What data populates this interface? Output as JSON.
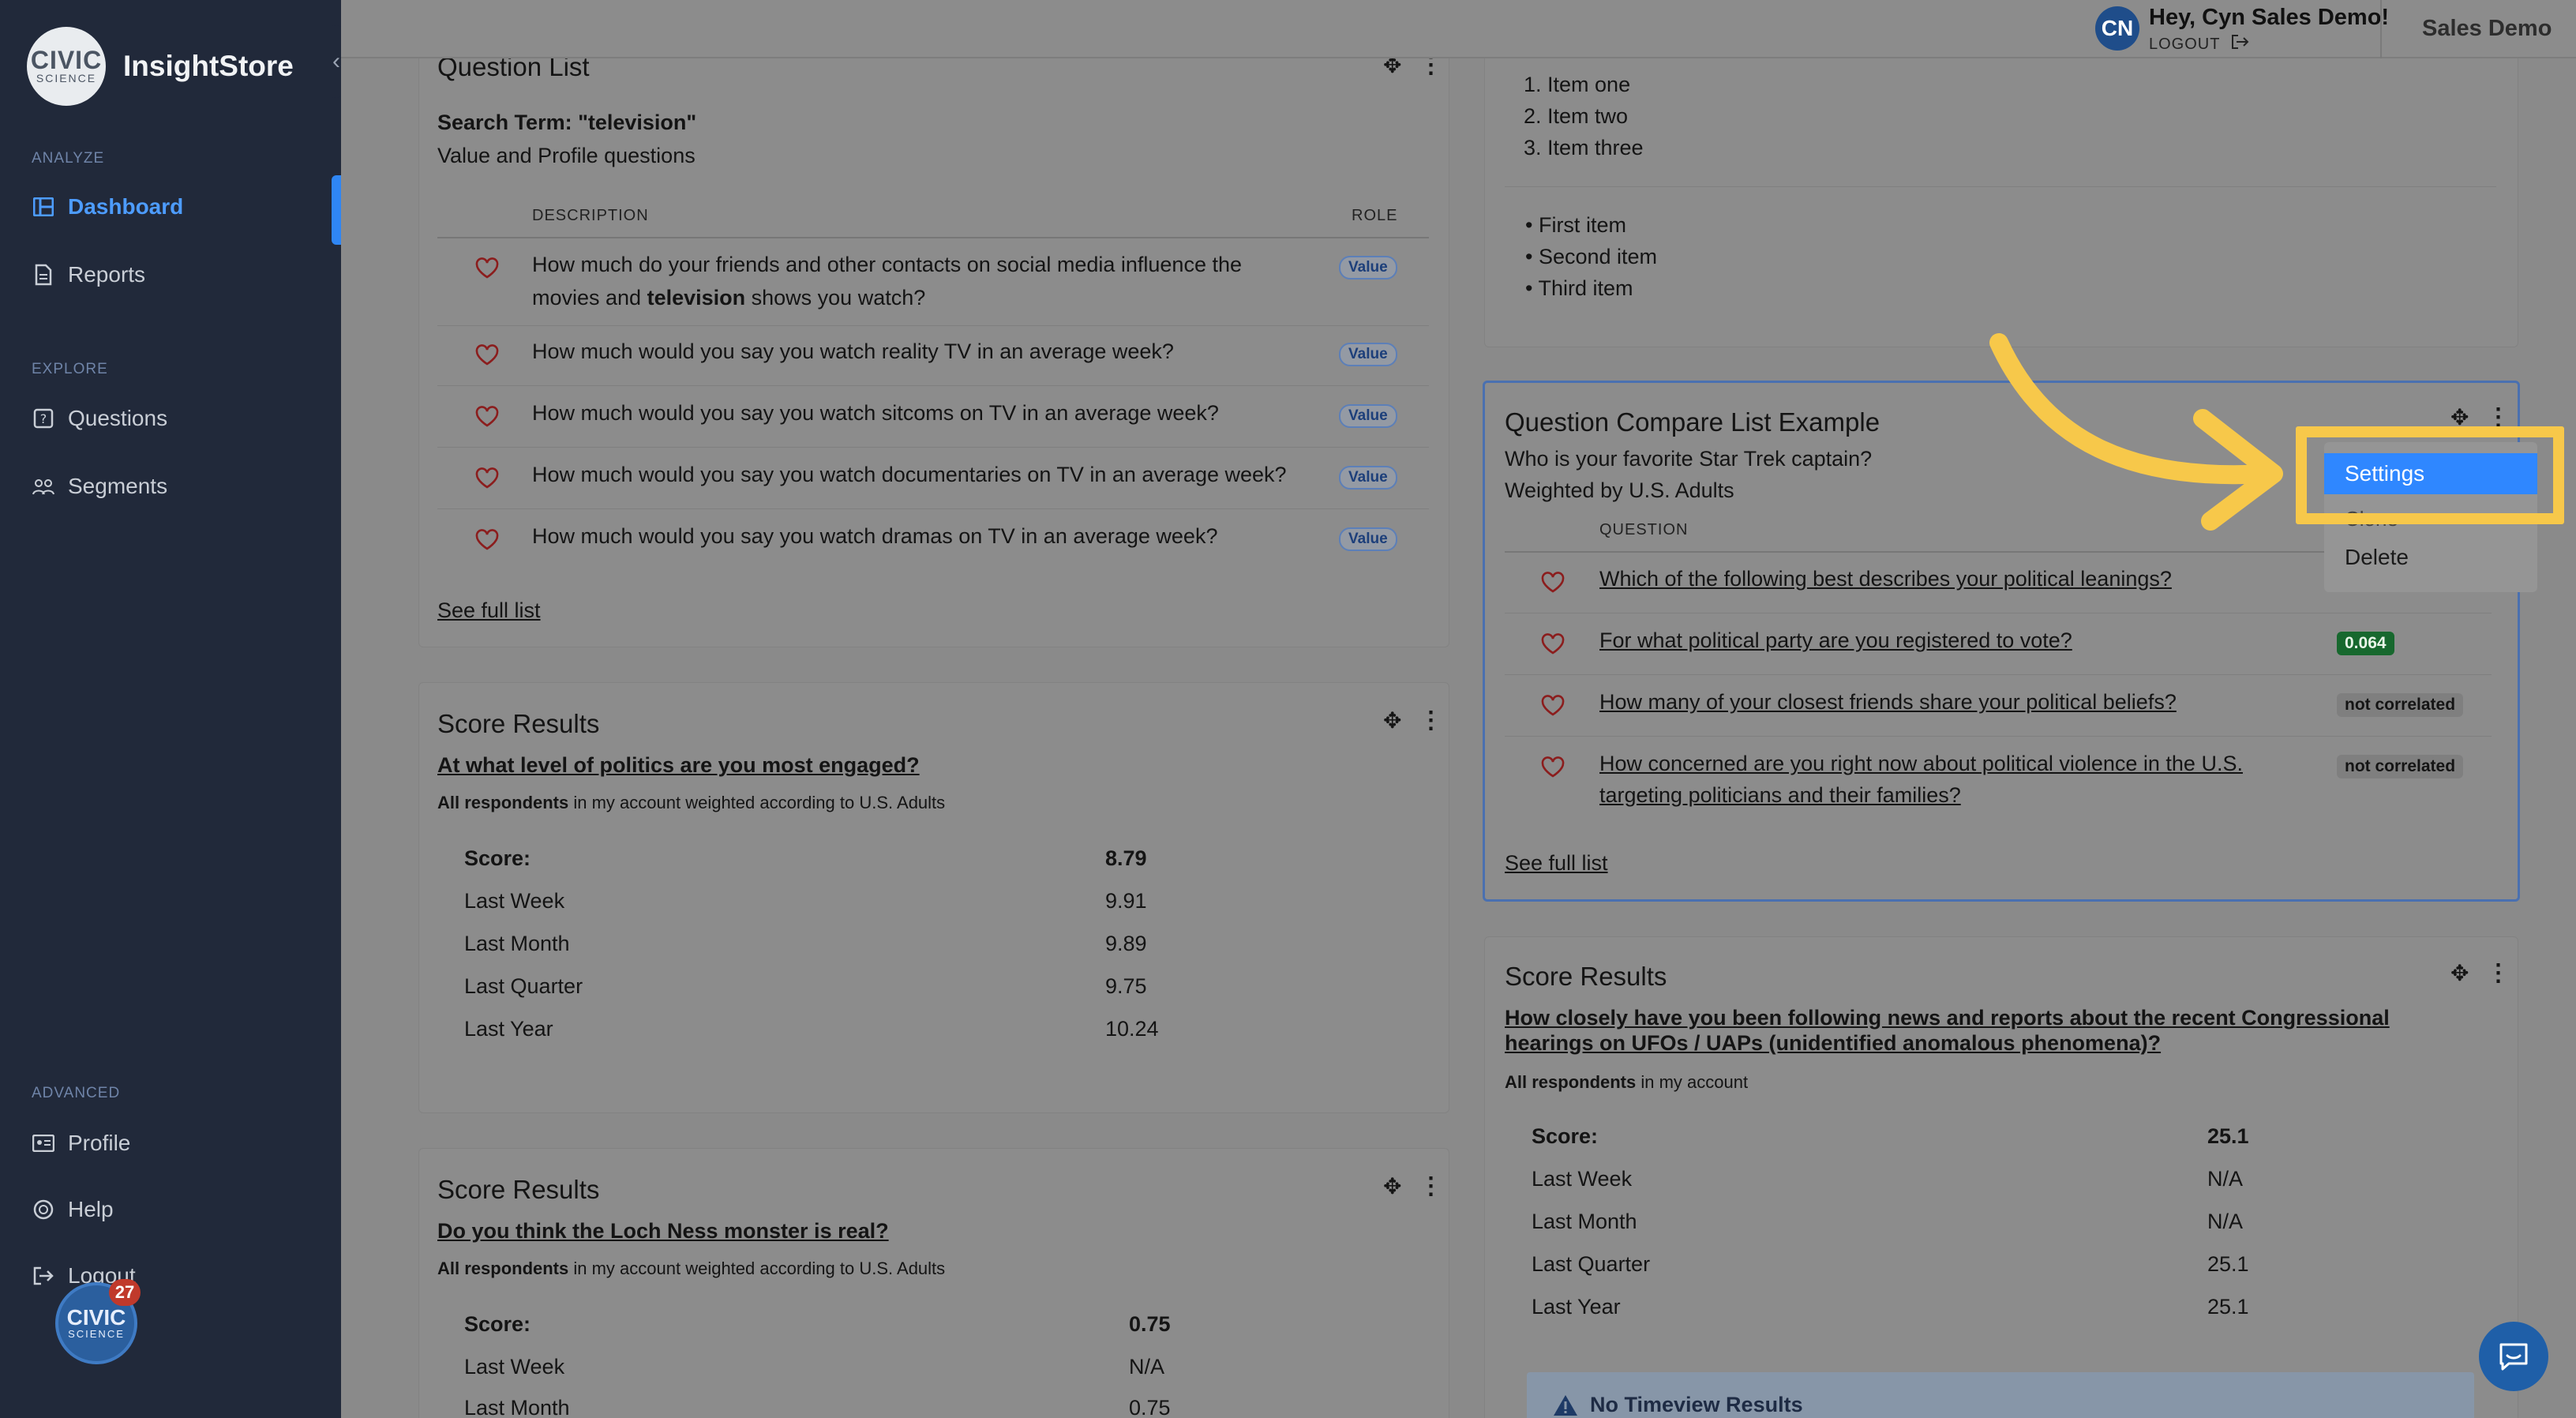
{
  "sidebar": {
    "logo_line1": "CIVIC",
    "logo_line2": "SCIENCE",
    "app_name": "InsightStore",
    "collapse_glyph": "‹",
    "sections": {
      "analyze": "ANALYZE",
      "explore": "EXPLORE",
      "advanced": "ADVANCED"
    },
    "items": {
      "dashboard": "Dashboard",
      "reports": "Reports",
      "questions": "Questions",
      "segments": "Segments",
      "profile": "Profile",
      "help": "Help",
      "logout": "Logout"
    },
    "badge": {
      "line1": "CIVIC",
      "line2": "SCIENCE",
      "count": "27"
    }
  },
  "topbar": {
    "avatar_initials": "CN",
    "greeting": "Hey, Cyn Sales Demo!",
    "logout": "LOGOUT",
    "account": "Sales Demo"
  },
  "question_list": {
    "title": "Question List",
    "search_term": "Search Term: \"television\"",
    "subtitle": "Value and Profile questions",
    "col_description": "DESCRIPTION",
    "col_role": "ROLE",
    "row0_pre": "How much do your friends and other contacts on social media influence the",
    "row0_mid": "movies and ",
    "row0_bold": "television",
    "row0_post": " shows you watch?",
    "rows": [
      {
        "text": "How much would you say you watch reality TV in an average week?",
        "role": "Value"
      },
      {
        "text": "How much would you say you watch sitcoms on TV in an average week?",
        "role": "Value"
      },
      {
        "text": "How much would you say you watch documentaries on TV in an average week?",
        "role": "Value"
      },
      {
        "text": "How much would you say you watch dramas on TV in an average week?",
        "role": "Value"
      }
    ],
    "row0_role": "Value",
    "see_full": "See full list"
  },
  "lists_card": {
    "ordered": [
      "1. Item one",
      "2. Item two",
      "3. Item three"
    ],
    "unordered": [
      "• First item",
      "• Second item",
      "• Third item"
    ]
  },
  "compare_list": {
    "title": "Question Compare List Example",
    "line1": "Who is your favorite Star Trek captain?",
    "line2": "Weighted by U.S. Adults",
    "col_question": "QUESTION",
    "rows": [
      {
        "text": "Which of the following best describes your political leanings?"
      },
      {
        "text": "For what political party are you registered to vote?",
        "badge": "0.064"
      },
      {
        "text": "How many of your closest friends share your political beliefs?",
        "badge": "not correlated"
      },
      {
        "text1": "How concerned are you right now about political violence in the U.S.",
        "text2": "targeting politicians and their families?",
        "badge": "not correlated"
      }
    ],
    "see_full": "See full list"
  },
  "dropdown": {
    "settings": "Settings",
    "clone": "Clone",
    "delete": "Delete"
  },
  "score1": {
    "title": "Score Results",
    "question": "At what level of politics are you most engaged?",
    "resp_bold": "All respondents",
    "resp_rest": " in my account weighted according to U.S. Adults",
    "rows": [
      {
        "label": "Score:",
        "value": "8.79"
      },
      {
        "label": "Last Week",
        "value": "9.91"
      },
      {
        "label": "Last Month",
        "value": "9.89"
      },
      {
        "label": "Last Quarter",
        "value": "9.75"
      },
      {
        "label": "Last Year",
        "value": "10.24"
      }
    ]
  },
  "score2": {
    "title": "Score Results",
    "question": "Do you think the Loch Ness monster is real?",
    "resp_bold": "All respondents",
    "resp_rest": " in my account weighted according to U.S. Adults",
    "rows": [
      {
        "label": "Score:",
        "value": "0.75"
      },
      {
        "label": "Last Week",
        "value": "N/A"
      },
      {
        "label": "Last Month",
        "value": "0.75"
      }
    ]
  },
  "score3": {
    "title": "Score Results",
    "question1": "How closely have you been following news and reports about the recent Congressional",
    "question2": "hearings on UFOs / UAPs (unidentified anomalous phenomena)?",
    "resp_bold": "All respondents",
    "resp_rest": " in my account",
    "rows": [
      {
        "label": "Score:",
        "value": "25.1"
      },
      {
        "label": "Last Week",
        "value": "N/A"
      },
      {
        "label": "Last Month",
        "value": "N/A"
      },
      {
        "label": "Last Quarter",
        "value": "25.1"
      },
      {
        "label": "Last Year",
        "value": "25.1"
      }
    ],
    "notice": "No Timeview Results"
  },
  "colors": {
    "sidebar_bg": "#21293a",
    "accent_blue": "#2f87ff",
    "highlight_yellow": "#f7c84a",
    "correlation_green": "#17682e"
  }
}
